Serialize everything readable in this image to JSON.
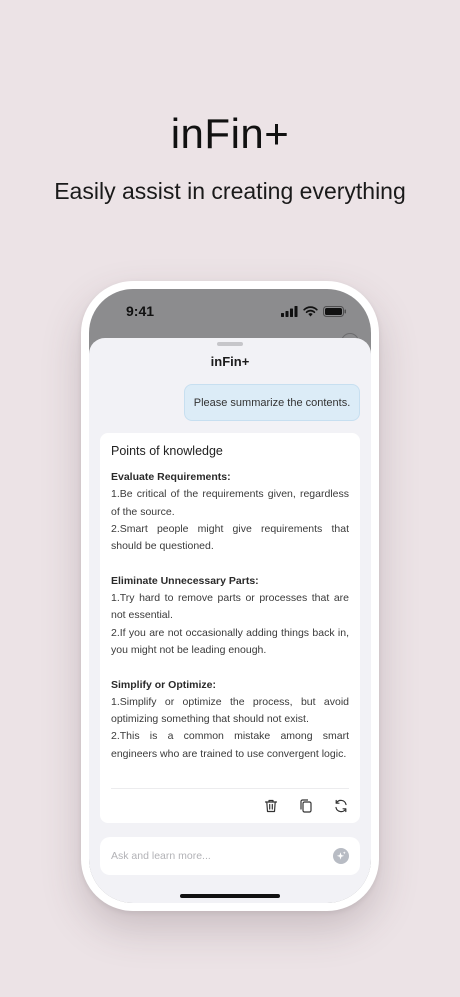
{
  "hero": {
    "title": "inFin+",
    "subtitle": "Easily assist in creating everything"
  },
  "status_bar": {
    "time": "9:41",
    "icons": [
      "cellular-signal-icon",
      "wifi-icon",
      "battery-icon"
    ]
  },
  "sheet": {
    "title": "inFin+"
  },
  "user_message": "Please summarize the contents.",
  "answer": {
    "title": "Points of knowledge",
    "sections": [
      {
        "heading": "Evaluate Requirements:",
        "items": [
          "1.Be critical of the requirements given, regardless of the source.",
          "2.Smart people might give requirements that should be questioned."
        ]
      },
      {
        "heading": "Eliminate Unnecessary Parts:",
        "items": [
          "1.Try hard to remove parts or processes that are not essential.",
          "2.If you are not occasionally adding things back in, you might not be leading enough."
        ]
      },
      {
        "heading": "Simplify or Optimize:",
        "items": [
          "1.Simplify or optimize the process, but avoid optimizing something that should not exist.",
          "2.This is a common mistake among smart engineers who are trained to use convergent logic."
        ]
      }
    ],
    "actions": [
      "trash-icon",
      "copy-icon",
      "refresh-icon"
    ]
  },
  "input": {
    "placeholder": "Ask and learn more...",
    "value": ""
  },
  "colors": {
    "background": "#ece3e6",
    "user_bubble": "#dcecf7",
    "sheet": "#f2f2f6"
  }
}
